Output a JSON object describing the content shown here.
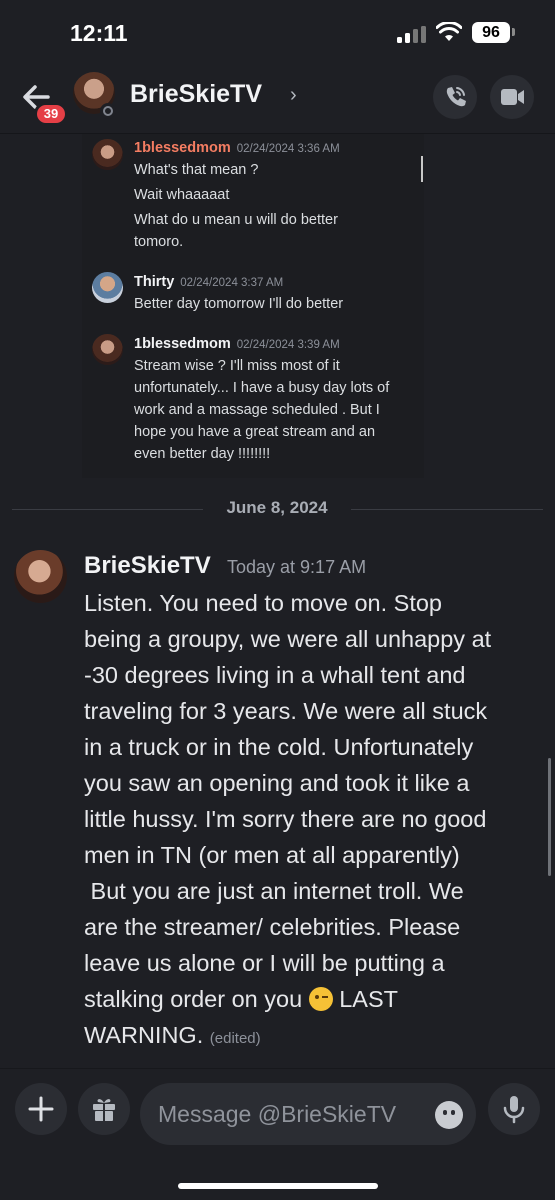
{
  "status_bar": {
    "time": "12:11",
    "battery": "96"
  },
  "header": {
    "title": "BrieSkieTV",
    "chevron": "›",
    "unread_badge": "39"
  },
  "embed_messages": [
    {
      "author": "1blessedmom",
      "author_color": "#f47d62",
      "timestamp": "02/24/2024 3:36 AM",
      "lines": [
        "What's that mean ?",
        "Wait whaaaaat",
        "What do u mean u will do better",
        "tomoro."
      ]
    },
    {
      "author": "Thirty",
      "author_color": "#f2f3f5",
      "timestamp": "02/24/2024 3:37 AM",
      "lines": [
        "Better day tomorrow I'll  do better"
      ]
    },
    {
      "author": "1blessedmom",
      "author_color": "#f2f3f5",
      "timestamp": "02/24/2024 3:39 AM",
      "lines": [
        "Stream wise ? I'll miss most of it",
        "unfortunately... I have a busy day lots of",
        "work and a massage scheduled . But I",
        "hope you have a great stream and an",
        "even better day  !!!!!!!!"
      ]
    }
  ],
  "date_divider": "June 8, 2024",
  "main_message": {
    "author": "BrieSkieTV",
    "timestamp": "Today at 9:17 AM",
    "lines": [
      "Listen. You need to move on. Stop",
      "being a groupy, we were all unhappy at",
      "-30 degrees  living in a whall tent and",
      "traveling for 3 years. We were all stuck",
      "in a truck or in the cold. Unfortunately",
      "you saw an opening and took it like a",
      "little hussy. I'm sorry there are no good",
      "men in TN (or men at all apparently)",
      " But you are just an internet troll. We",
      "are the streamer/ celebrities.  Please",
      "leave us alone or I will be putting a",
      "stalking order on you"
    ],
    "after_emoji": " LAST",
    "last_line": "WARNING.",
    "edited": "(edited)",
    "emoji": "winking-face"
  },
  "composer": {
    "placeholder": "Message @BrieSkieTV"
  },
  "icons": [
    "back-arrow-icon",
    "phone-call-icon",
    "video-camera-icon",
    "plus-icon",
    "gift-icon",
    "emoji-icon",
    "microphone-icon",
    "wifi-icon",
    "signal-icon",
    "battery-icon"
  ]
}
